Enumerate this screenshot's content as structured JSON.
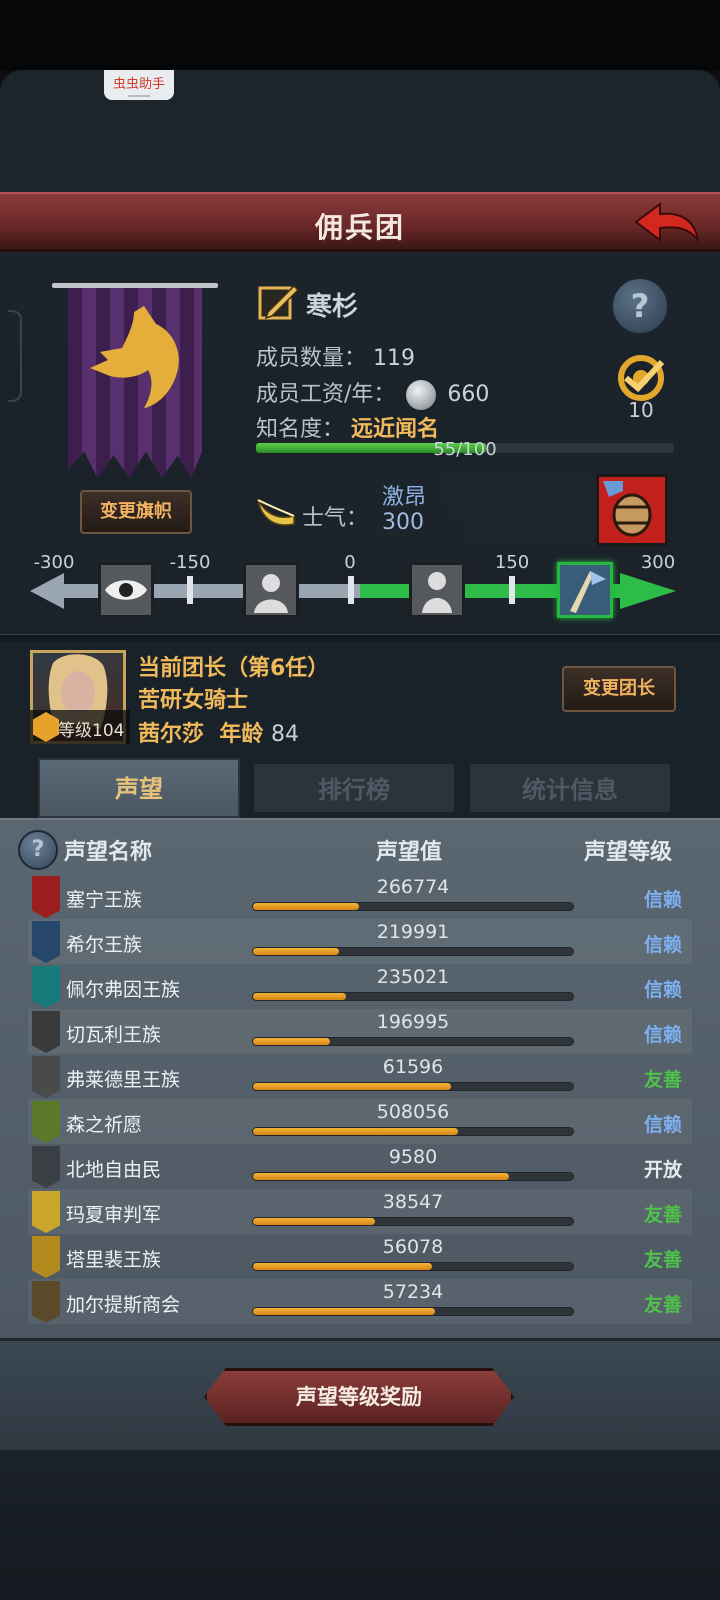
{
  "overlay_chip": "虫虫助手",
  "header": {
    "title": "佣兵团"
  },
  "banner": {
    "change_label": "变更旗帜"
  },
  "leader": {
    "name": "寒杉",
    "members_label": "成员数量：",
    "members_value": "119",
    "salary_label": "成员工资/年：",
    "salary_value": "660",
    "fame_label": "知名度：",
    "fame_value": "远近闻名",
    "fame_progress_text": "55/100",
    "fame_progress": 0.55,
    "achievement_count": "10"
  },
  "morale": {
    "label": "士气：",
    "state": "激昂",
    "value": "300",
    "scale_ticks": [
      "-300",
      "-150",
      "0",
      "150",
      "300"
    ],
    "current": 300
  },
  "commander": {
    "title": "当前团长（第6任）",
    "class": "苦研女骑士",
    "name": "茜尔莎",
    "age_label": "年龄",
    "age_value": "84",
    "level_text": "等级104",
    "change_label": "变更团长"
  },
  "tabs": [
    {
      "label": "声望",
      "active": true
    },
    {
      "label": "排行榜",
      "active": false
    },
    {
      "label": "统计信息",
      "active": false
    }
  ],
  "reputation_table": {
    "headers": [
      "声望名称",
      "声望值",
      "声望等级"
    ],
    "rows": [
      {
        "name": "塞宁王族",
        "value": "266774",
        "level": "信赖",
        "progress": 0.33,
        "color": "#9b1e1e",
        "level_color": "#7cb0f0"
      },
      {
        "name": "希尔王族",
        "value": "219991",
        "level": "信赖",
        "progress": 0.27,
        "color": "#26466a",
        "level_color": "#7cb0f0"
      },
      {
        "name": "佩尔弗因王族",
        "value": "235021",
        "level": "信赖",
        "progress": 0.29,
        "color": "#177a7a",
        "level_color": "#7cb0f0"
      },
      {
        "name": "切瓦利王族",
        "value": "196995",
        "level": "信赖",
        "progress": 0.24,
        "color": "#3a3a3a",
        "level_color": "#7cb0f0"
      },
      {
        "name": "弗莱德里王族",
        "value": "61596",
        "level": "友善",
        "progress": 0.62,
        "color": "#4a4a4a",
        "level_color": "#4fc24a"
      },
      {
        "name": "森之祈愿",
        "value": "508056",
        "level": "信赖",
        "progress": 0.64,
        "color": "#5a7a2a",
        "level_color": "#7cb0f0"
      },
      {
        "name": "北地自由民",
        "value": "9580",
        "level": "开放",
        "progress": 0.8,
        "color": "#3a3f44",
        "level_color": "#e6eaee"
      },
      {
        "name": "玛夏审判军",
        "value": "38547",
        "level": "友善",
        "progress": 0.38,
        "color": "#c9a52a",
        "level_color": "#4fc24a"
      },
      {
        "name": "塔里裴王族",
        "value": "56078",
        "level": "友善",
        "progress": 0.56,
        "color": "#b38a1e",
        "level_color": "#4fc24a"
      },
      {
        "name": "加尔提斯商会",
        "value": "57234",
        "level": "友善",
        "progress": 0.57,
        "color": "#5a4a2a",
        "level_color": "#4fc24a"
      }
    ]
  },
  "footer": {
    "reward_label": "声望等级奖励"
  },
  "colors": {
    "accent_gold": "#f0b95a",
    "morale_green": "#2cbc47",
    "title_red": "#7a2e2e"
  }
}
